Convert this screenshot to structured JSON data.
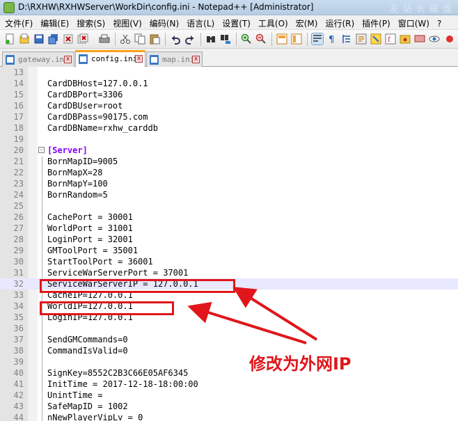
{
  "window": {
    "title": "D:\\RXHW\\RXHWServer\\WorkDir\\config.ini - Notepad++ [Administrator]",
    "watermark": "友 站 长 磁 盘"
  },
  "menu": [
    "文件(F)",
    "编辑(E)",
    "搜索(S)",
    "视图(V)",
    "编码(N)",
    "语言(L)",
    "设置(T)",
    "工具(O)",
    "宏(M)",
    "运行(R)",
    "插件(P)",
    "窗口(W)",
    "?"
  ],
  "toolbar": {
    "icons": [
      "new-file-icon",
      "open-file-icon",
      "save-icon",
      "save-all-icon",
      "close-icon",
      "close-all-icon",
      "print-icon",
      "cut-icon",
      "copy-icon",
      "paste-icon",
      "undo-icon",
      "redo-icon",
      "find-icon",
      "replace-icon",
      "zoom-in-icon",
      "zoom-out-icon",
      "sync-v-icon",
      "sync-h-icon",
      "word-wrap-icon",
      "show-all-chars-icon",
      "indent-guide-icon",
      "udl-icon",
      "doc-map-icon",
      "function-list-icon",
      "folder-icon",
      "monitor-icon",
      "record-macro-icon"
    ]
  },
  "tabs": [
    {
      "label": "gateway.ini",
      "close": "x",
      "active": false
    },
    {
      "label": "config.ini",
      "close": "x",
      "active": true
    },
    {
      "label": "map.ini",
      "close": "x",
      "active": false
    }
  ],
  "editor": {
    "current_line": 32,
    "lines": [
      {
        "n": "13",
        "key": "",
        "sep": "",
        "val": ""
      },
      {
        "n": "14",
        "key": "CardDBHost",
        "sep": "=",
        "val": "127.0.0.1"
      },
      {
        "n": "15",
        "key": "CardDBPort",
        "sep": "=",
        "val": "3306"
      },
      {
        "n": "16",
        "key": "CardDBUser",
        "sep": "=",
        "val": "root"
      },
      {
        "n": "17",
        "key": "CardDBPass",
        "sep": "=",
        "val": "90175.com"
      },
      {
        "n": "18",
        "key": "CardDBName",
        "sep": "=",
        "val": "rxhw_carddb"
      },
      {
        "n": "19",
        "key": "",
        "sep": "",
        "val": ""
      },
      {
        "n": "20",
        "key": "[Server]",
        "sep": "",
        "val": "",
        "section": true
      },
      {
        "n": "21",
        "key": "BornMapID",
        "sep": "=",
        "val": "9005"
      },
      {
        "n": "22",
        "key": "BornMapX",
        "sep": "=",
        "val": "28"
      },
      {
        "n": "23",
        "key": "BornMapY",
        "sep": "=",
        "val": "100"
      },
      {
        "n": "24",
        "key": "BornRandom",
        "sep": "=",
        "val": "5"
      },
      {
        "n": "25",
        "key": "",
        "sep": "",
        "val": ""
      },
      {
        "n": "26",
        "key": "CachePort",
        "sep": " = ",
        "val": "30001"
      },
      {
        "n": "27",
        "key": "WorldPort",
        "sep": " = ",
        "val": "31001"
      },
      {
        "n": "28",
        "key": "LoginPort",
        "sep": " = ",
        "val": "32001"
      },
      {
        "n": "29",
        "key": "GMToolPort",
        "sep": " = ",
        "val": "35001"
      },
      {
        "n": "30",
        "key": "StartToolPort",
        "sep": " = ",
        "val": "36001"
      },
      {
        "n": "31",
        "key": "ServiceWarServerPort",
        "sep": " = ",
        "val": "37001"
      },
      {
        "n": "32",
        "key": "ServiceWarServerIP",
        "sep": " = ",
        "val": "127.0.0.1"
      },
      {
        "n": "33",
        "key": "CacheIP",
        "sep": "=",
        "val": "127.0.0.1"
      },
      {
        "n": "34",
        "key": "WorldIP",
        "sep": "=",
        "val": "127.0.0.1"
      },
      {
        "n": "35",
        "key": "LoginIP",
        "sep": "=",
        "val": "127.0.0.1"
      },
      {
        "n": "36",
        "key": "",
        "sep": "",
        "val": ""
      },
      {
        "n": "37",
        "key": "SendGMCommands",
        "sep": "=",
        "val": "0"
      },
      {
        "n": "38",
        "key": "CommandIsValid",
        "sep": "=",
        "val": "0"
      },
      {
        "n": "39",
        "key": "",
        "sep": "",
        "val": ""
      },
      {
        "n": "40",
        "key": "SignKey",
        "sep": "=",
        "val": "8552C2B3C66E05AF6345"
      },
      {
        "n": "41",
        "key": "InitTime",
        "sep": " = ",
        "val": "2017-12-18-18:00:00"
      },
      {
        "n": "42",
        "key": "UnintTime",
        "sep": " = ",
        "val": ""
      },
      {
        "n": "43",
        "key": "SafeMapID",
        "sep": " = ",
        "val": "1002"
      },
      {
        "n": "44",
        "key": "nNewPlayerVipLv",
        "sep": " = ",
        "val": "0"
      }
    ]
  },
  "annotation": {
    "text": "修改为外网IP",
    "color": "#e0161b"
  }
}
